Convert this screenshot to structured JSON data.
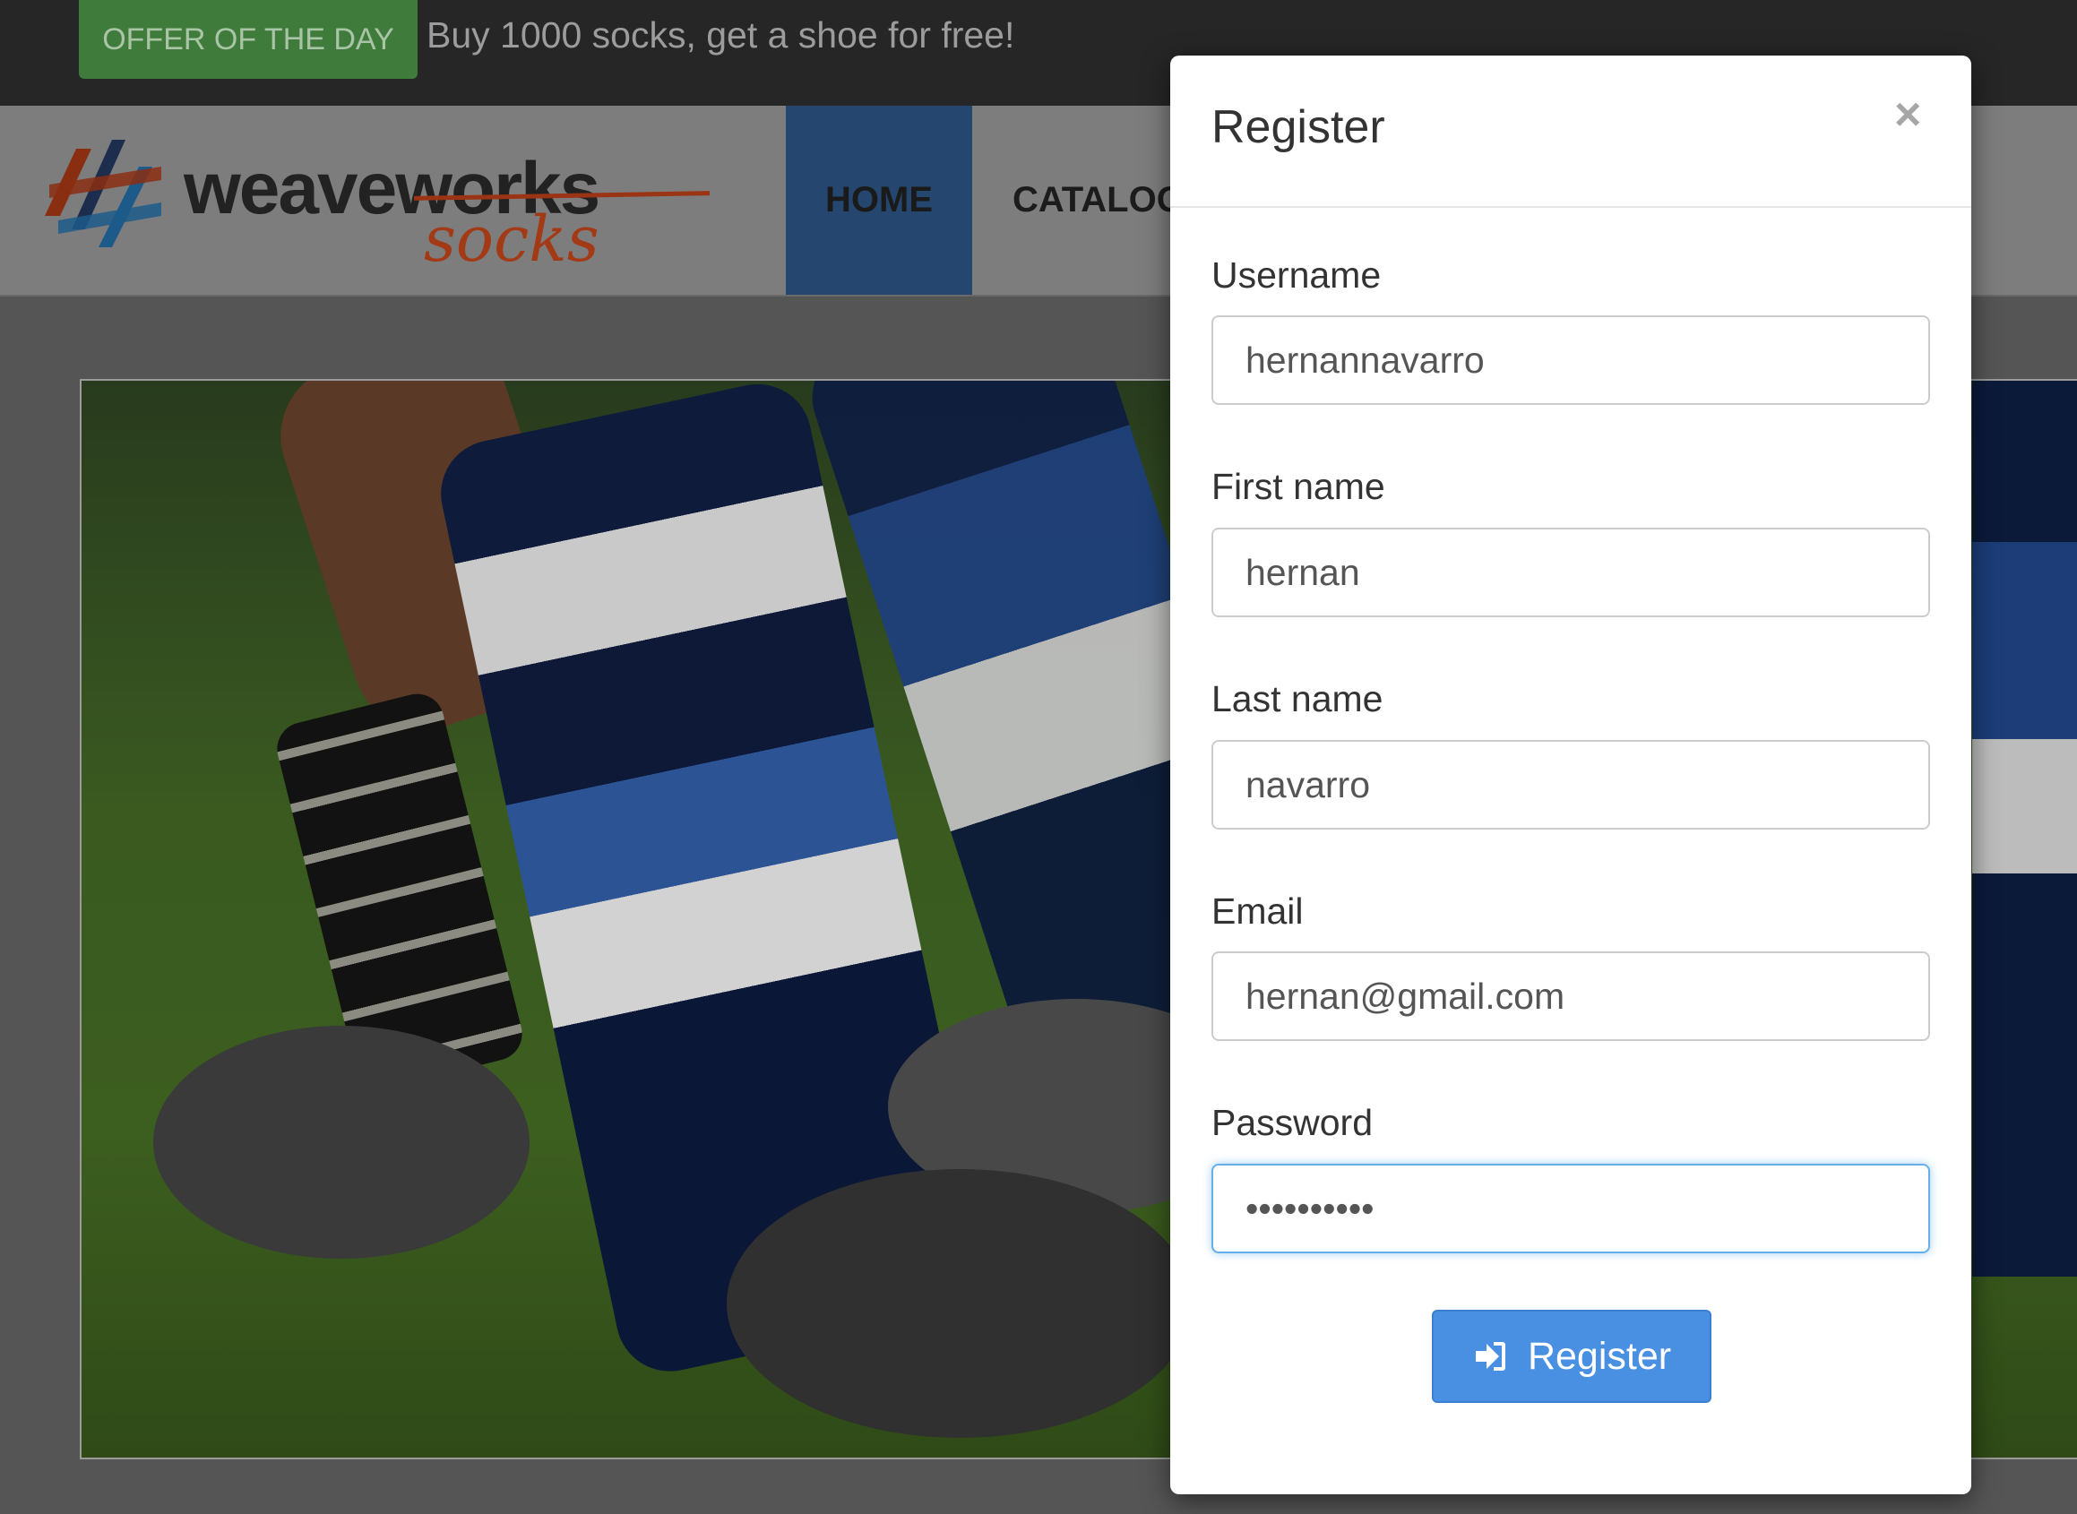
{
  "topbar": {
    "offer_badge": "OFFER OF THE DAY",
    "offer_text": "Buy 1000 socks, get a shoe for free!"
  },
  "navbar": {
    "logo_word": "weaveworks",
    "logo_sub": "socks",
    "items": [
      {
        "label": "HOME",
        "active": true
      },
      {
        "label": "CATALOG",
        "active": false
      }
    ]
  },
  "modal": {
    "title": "Register",
    "close_symbol": "×",
    "fields": [
      {
        "label": "Username",
        "value": "hernannavarro",
        "type": "text"
      },
      {
        "label": "First name",
        "value": "hernan",
        "type": "text"
      },
      {
        "label": "Last name",
        "value": "navarro",
        "type": "text"
      },
      {
        "label": "Email",
        "value": "hernan@gmail.com",
        "type": "text"
      },
      {
        "label": "Password",
        "value": "hernanpass",
        "type": "password",
        "focused": true
      }
    ],
    "submit_label": "Register",
    "submit_icon": "sign-in-icon"
  },
  "colors": {
    "primary_button": "#4a90e2",
    "offer_badge": "#3f7b3b",
    "nav_active": "#25476f",
    "focus_border": "#66afe9"
  }
}
